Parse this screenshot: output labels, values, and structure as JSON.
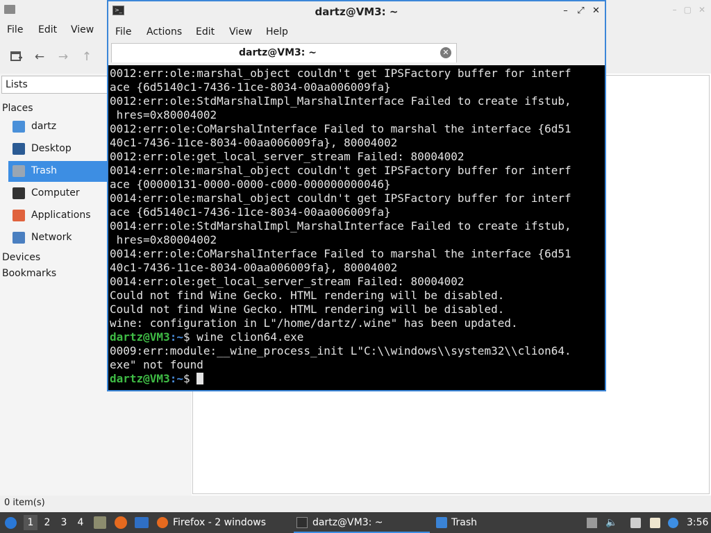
{
  "file_manager": {
    "menu": [
      "File",
      "Edit",
      "View"
    ],
    "sidebar": {
      "lists_label": "Lists",
      "places_header": "Places",
      "places": [
        {
          "label": "dartz",
          "icon": "home-folder-icon",
          "color": "#4a90d9"
        },
        {
          "label": "Desktop",
          "icon": "desktop-icon",
          "color": "#2b5b94"
        },
        {
          "label": "Trash",
          "icon": "trash-icon",
          "color": "#9aa6b3",
          "active": true
        },
        {
          "label": "Computer",
          "icon": "computer-icon",
          "color": "#333333"
        },
        {
          "label": "Applications",
          "icon": "applications-icon",
          "color": "#e0623d"
        },
        {
          "label": "Network",
          "icon": "network-icon",
          "color": "#4a7fc0"
        }
      ],
      "devices_header": "Devices",
      "bookmarks_header": "Bookmarks"
    },
    "status": "0 item(s)"
  },
  "terminal": {
    "title": "dartz@VM3: ~",
    "menu": [
      "File",
      "Actions",
      "Edit",
      "View",
      "Help"
    ],
    "tab_label": "dartz@VM3: ~",
    "lines": [
      "0012:err:ole:marshal_object couldn't get IPSFactory buffer for interf",
      "ace {6d5140c1-7436-11ce-8034-00aa006009fa}",
      "0012:err:ole:StdMarshalImpl_MarshalInterface Failed to create ifstub,",
      " hres=0x80004002",
      "0012:err:ole:CoMarshalInterface Failed to marshal the interface {6d51",
      "40c1-7436-11ce-8034-00aa006009fa}, 80004002",
      "0012:err:ole:get_local_server_stream Failed: 80004002",
      "0014:err:ole:marshal_object couldn't get IPSFactory buffer for interf",
      "ace {00000131-0000-0000-c000-000000000046}",
      "0014:err:ole:marshal_object couldn't get IPSFactory buffer for interf",
      "ace {6d5140c1-7436-11ce-8034-00aa006009fa}",
      "0014:err:ole:StdMarshalImpl_MarshalInterface Failed to create ifstub,",
      " hres=0x80004002",
      "0014:err:ole:CoMarshalInterface Failed to marshal the interface {6d51",
      "40c1-7436-11ce-8034-00aa006009fa}, 80004002",
      "0014:err:ole:get_local_server_stream Failed: 80004002",
      "Could not find Wine Gecko. HTML rendering will be disabled.",
      "Could not find Wine Gecko. HTML rendering will be disabled.",
      "wine: configuration in L\"/home/dartz/.wine\" has been updated."
    ],
    "prompt_user_host": "dartz@VM3",
    "prompt_path": ":~",
    "prompt_symbol": "$",
    "command": " wine clion64.exe",
    "output_lines": [
      "0009:err:module:__wine_process_init L\"C:\\\\windows\\\\system32\\\\clion64.",
      "exe\" not found"
    ]
  },
  "taskbar": {
    "workspaces": [
      "1",
      "2",
      "3",
      "4"
    ],
    "active_workspace": "1",
    "windows": [
      {
        "label": "Firefox - 2 windows",
        "icon": "firefox-icon"
      },
      {
        "label": "dartz@VM3: ~",
        "icon": "terminal-icon",
        "active": true
      },
      {
        "label": "Trash",
        "icon": "folder-icon"
      }
    ],
    "clock": "3:56",
    "colors": {
      "accent": "#3d8ee3",
      "prompt": "#3fbc45"
    }
  }
}
